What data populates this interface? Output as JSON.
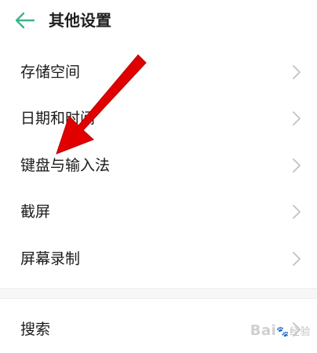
{
  "header": {
    "title": "其他设置",
    "back_icon": "back-arrow-icon",
    "accent": "#3db38a"
  },
  "items": [
    {
      "label": "存储空间"
    },
    {
      "label": "日期和时间"
    },
    {
      "label": "键盘与输入法"
    },
    {
      "label": "截屏"
    },
    {
      "label": "屏幕录制"
    }
  ],
  "search_item": {
    "label": "搜索"
  },
  "watermark": {
    "brand": "Bai",
    "suffix": "经验"
  },
  "annotation_color": "#e10000"
}
